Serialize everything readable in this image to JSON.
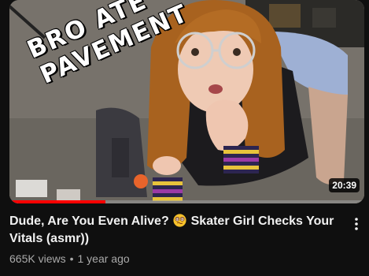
{
  "video": {
    "overlay_line1": "BRO ATE",
    "overlay_line2": "PAVEMENT",
    "duration": "20:39",
    "watched_fraction": 0.27,
    "title_part1": "Dude, Are You Even Alive?",
    "title_emoji": "dizzy-face-emoji",
    "title_part2": "Skater Girl Checks Your Vitals (asmr))",
    "views": "665K views",
    "separator": "•",
    "age": "1 year ago"
  },
  "icons": {
    "menu": "vertical-dots-icon"
  },
  "colors": {
    "background": "#0f0f0f",
    "progress": "#ff0000",
    "meta_text": "#aaaaaa",
    "title_text": "#f1f1f1"
  }
}
